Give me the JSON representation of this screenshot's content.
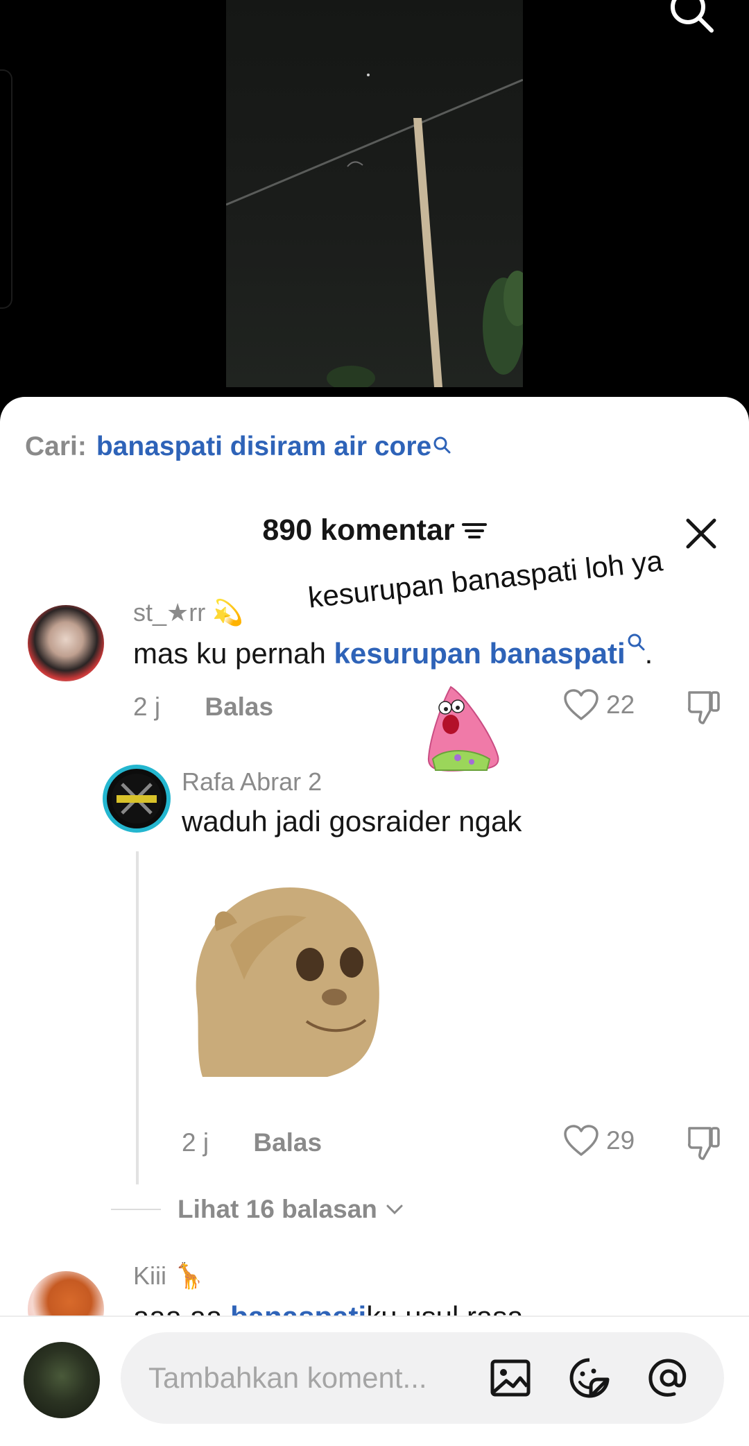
{
  "search": {
    "label": "Cari:",
    "query": "banaspati disiram air core"
  },
  "header": {
    "count_label": "890 komentar"
  },
  "overlay": {
    "text": "kesurupan banaspati loh ya"
  },
  "comments": [
    {
      "username": "st_★rr",
      "emoji": "💫",
      "text_before": "mas ku pernah ",
      "link": "kesurupan banaspati",
      "text_after": ".",
      "time": "2 j",
      "reply": "Balas",
      "likes": "22"
    },
    {
      "username": "Rafa Abrar 2",
      "text": "waduh jadi gosraider ngak",
      "time": "2 j",
      "reply": "Balas",
      "likes": "29"
    },
    {
      "username": "Kiii",
      "emoji": "🦒",
      "text_before": "aaa aa ",
      "link": "banaspati",
      "text_after": "ku usul rasa"
    }
  ],
  "view_replies": "Lihat 16 balasan",
  "composer": {
    "placeholder": "Tambahkan koment..."
  },
  "icons": {
    "search": "search-icon",
    "sort": "sort-icon",
    "close": "close-icon",
    "like": "heart-icon",
    "dislike": "thumbs-down-icon",
    "image": "image-icon",
    "sticker": "emoji-icon",
    "mention": "at-icon"
  },
  "colors": {
    "link": "#2e63b8",
    "muted": "#8a8a8a",
    "text": "#161616",
    "avatar_ring": "#24b6cf"
  }
}
